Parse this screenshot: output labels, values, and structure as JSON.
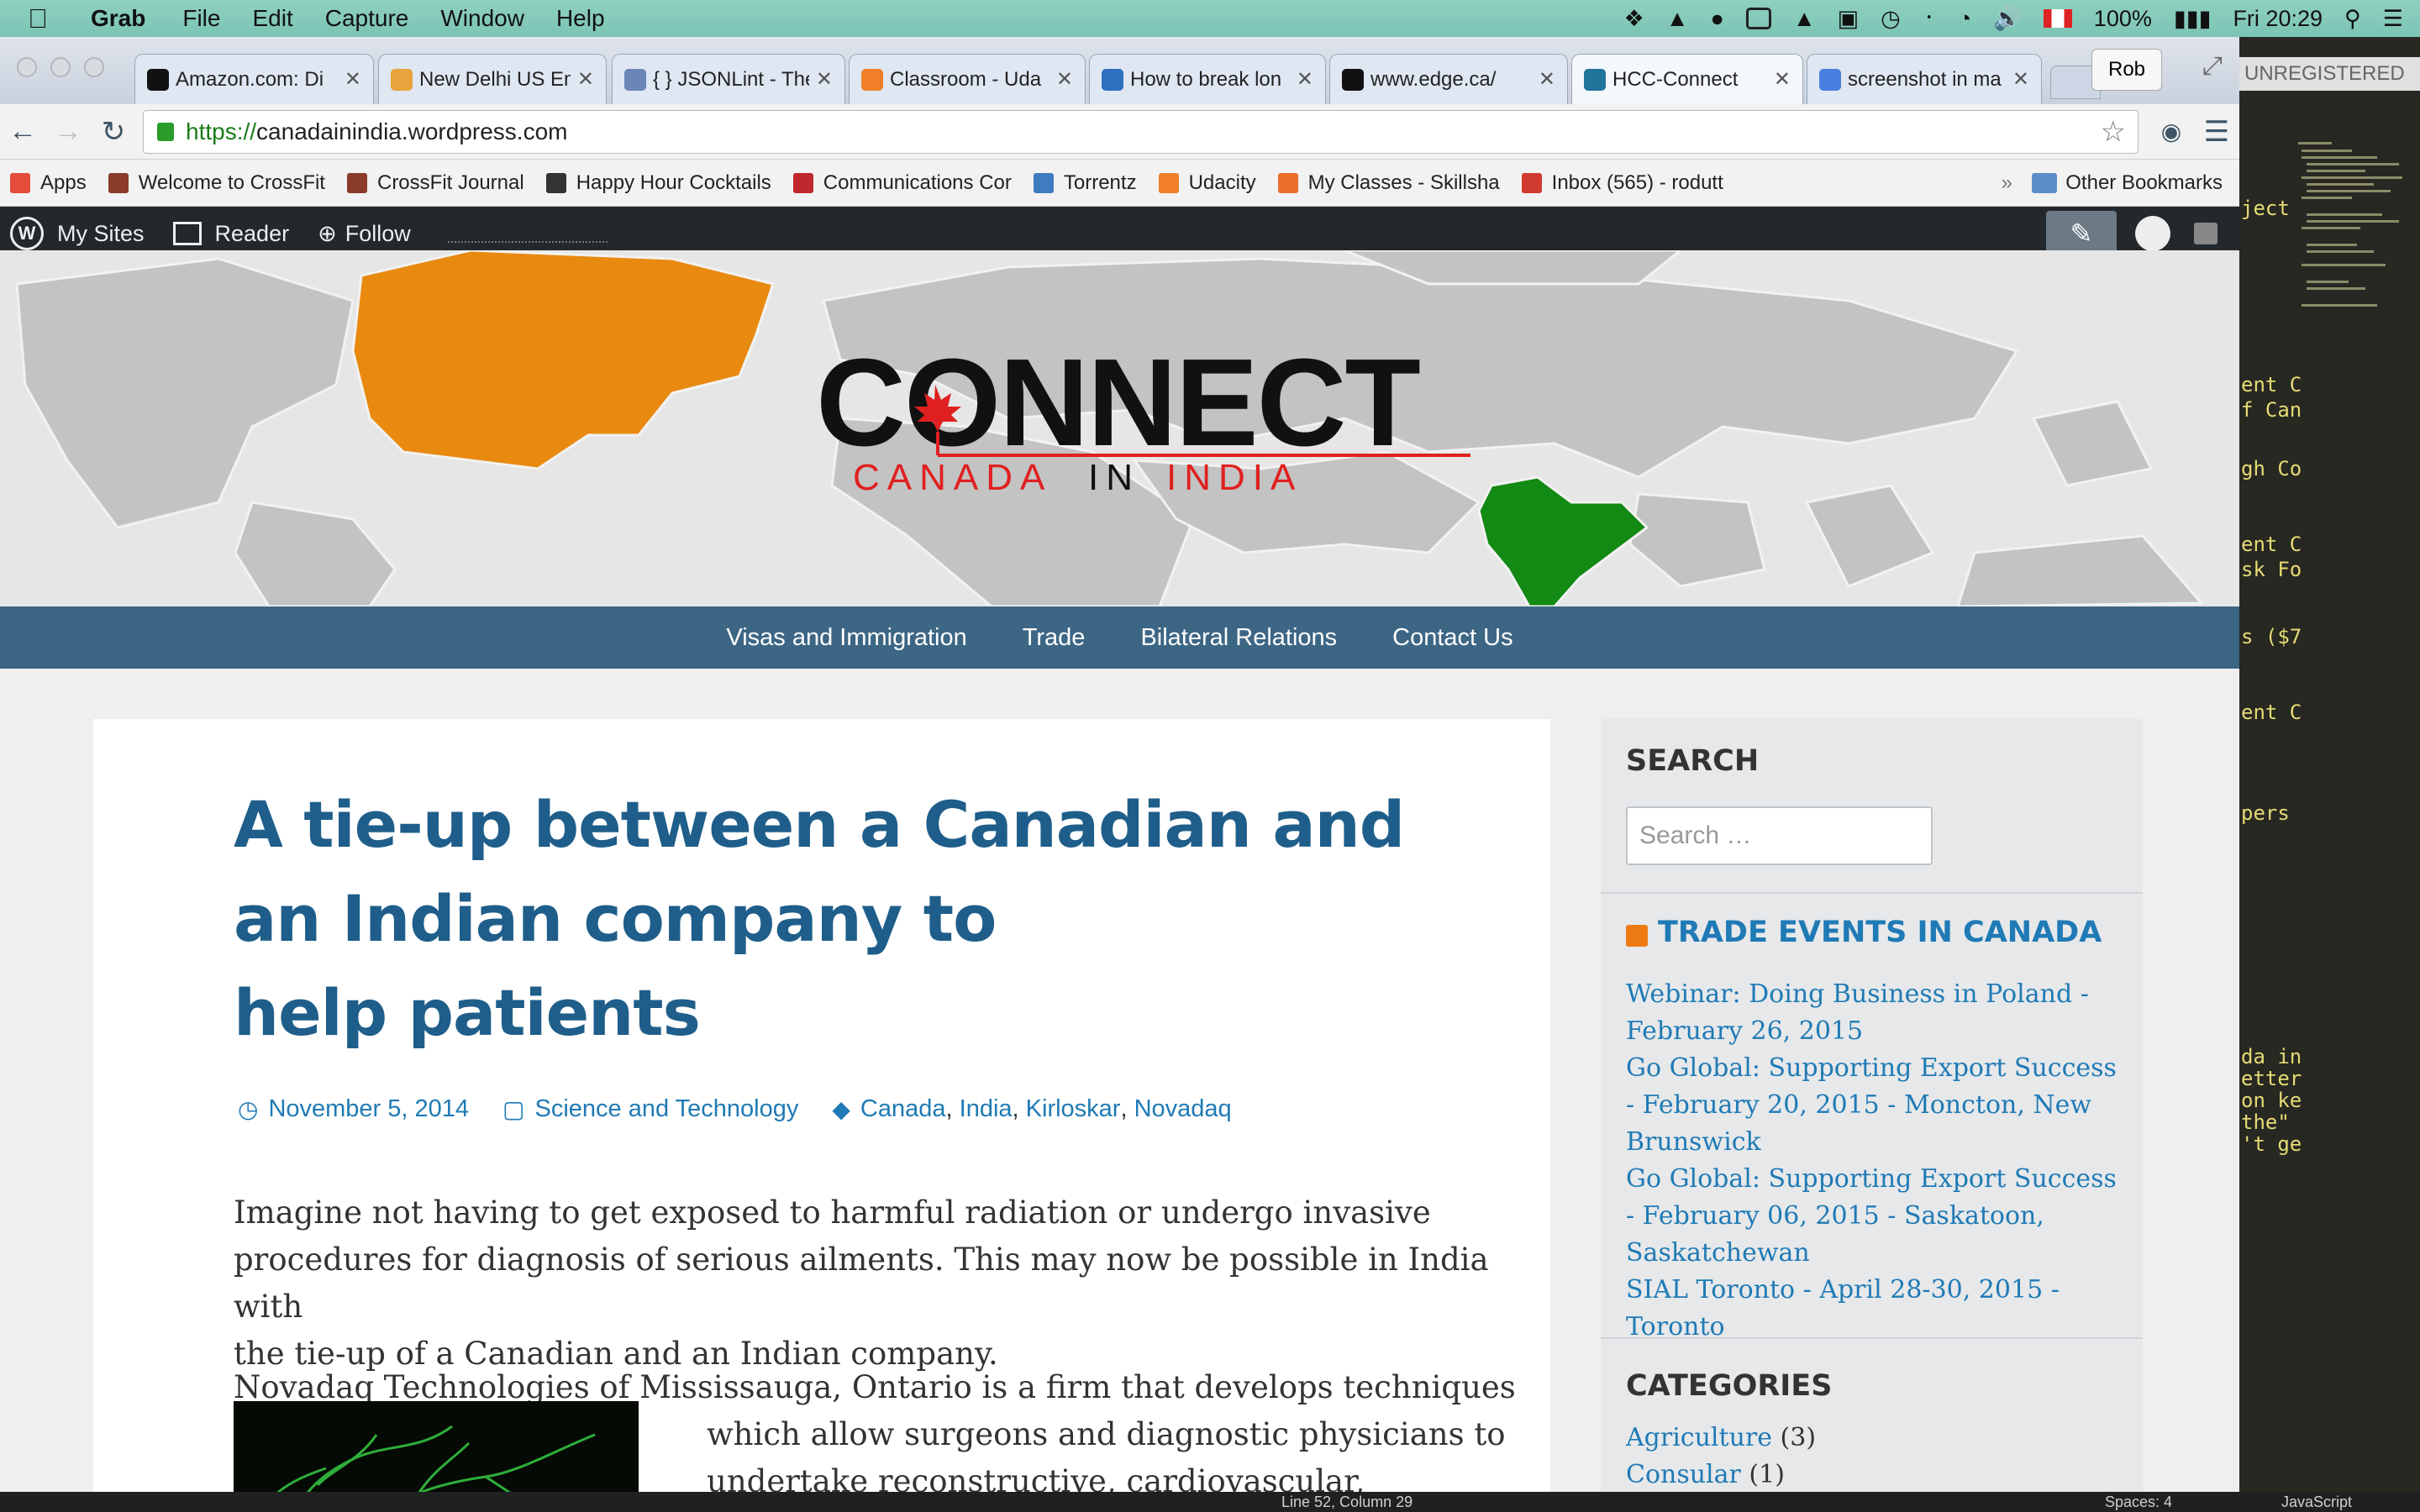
{
  "menubar": {
    "app": "Grab",
    "items": [
      "File",
      "Edit",
      "Capture",
      "Window",
      "Help"
    ],
    "battery": "100%",
    "clock": "Fri 20:29"
  },
  "tabs": [
    {
      "title": "Amazon.com: Di",
      "color": "#111111"
    },
    {
      "title": "New Delhi US Em",
      "color": "#e8a33c"
    },
    {
      "title": "{ } JSONLint - The JS",
      "color": "#6b86b6"
    },
    {
      "title": "Classroom - Uda",
      "color": "#f07f27"
    },
    {
      "title": "How to break lon",
      "color": "#2e6fbf"
    },
    {
      "title": "www.edge.ca/",
      "color": "#111111"
    },
    {
      "title": "HCC-Connect",
      "color": "#21759b"
    },
    {
      "title": "screenshot in ma",
      "color": "#4a7fe0"
    }
  ],
  "profile": "Rob",
  "address": {
    "scheme": "https://",
    "host": "canadainindia.wordpress.com"
  },
  "bookmarks": [
    {
      "label": "Apps",
      "color": "#e44c3c"
    },
    {
      "label": "Welcome to CrossFit",
      "color": "#8a3b2a"
    },
    {
      "label": "CrossFit Journal",
      "color": "#8a3b2a"
    },
    {
      "label": "Happy Hour Cocktails",
      "color": "#333333"
    },
    {
      "label": "Communications Cor",
      "color": "#c0282d"
    },
    {
      "label": "Torrentz",
      "color": "#3f7bbf"
    },
    {
      "label": "Udacity",
      "color": "#f07f27"
    },
    {
      "label": "My Classes - Skillsha",
      "color": "#e96f2a"
    },
    {
      "label": "Inbox (565) - rodutt",
      "color": "#d13b2f"
    }
  ],
  "bookmarks_other": "Other Bookmarks",
  "wpbar": {
    "my_sites": "My Sites",
    "reader": "Reader",
    "follow": "Follow"
  },
  "banner": {
    "logo_word": "CONNECT",
    "logo_sub_left": "CANADA",
    "logo_sub_mid": "IN",
    "logo_sub_right": "INDIA"
  },
  "nav": [
    "Visas and Immigration",
    "Trade",
    "Bilateral Relations",
    "Contact Us"
  ],
  "post": {
    "title_lines": [
      "A tie-up between a Canadian and",
      "an Indian company to",
      "help patients"
    ],
    "date": "November 5, 2014",
    "category": "Science and Technology",
    "tags": [
      "Canada",
      "India",
      "Kirloskar",
      "Novadaq"
    ],
    "para1_lines": [
      "Imagine not having to get exposed to harmful radiation or undergo invasive",
      "procedures for diagnosis of serious ailments. This may now be possible in India with",
      "the tie-up of a Canadian and an Indian company."
    ],
    "para2_first": "Novadaq Technologies of Mississauga, Ontario is a firm that develops  techniques",
    "para2_rest": [
      "which allow surgeons and diagnostic physicians to",
      "undertake reconstructive, cardiovascular,"
    ]
  },
  "sidebar": {
    "search_title": "SEARCH",
    "search_placeholder": "Search …",
    "rss_title": "TRADE EVENTS IN CANADA",
    "events": [
      "Webinar: Doing Business in Poland - February 26, 2015",
      "Go Global: Supporting Export Success - February 20, 2015 - Moncton, New Brunswick",
      "Go Global: Supporting Export Success - February 06, 2015 - Saskatoon, Saskatchewan",
      "SIAL Toronto - April 28-30, 2015 - Toronto"
    ],
    "categories_title": "CATEGORIES",
    "categories": [
      {
        "name": "Agriculture",
        "count": "(3)"
      },
      {
        "name": "Consular",
        "count": "(1)"
      }
    ]
  },
  "editor": {
    "unregistered": "UNREGISTERED",
    "snippets": [
      "ject",
      "ent C",
      "f Can",
      "gh Co",
      "ent C",
      "sk Fo",
      "s ($7",
      "ent C",
      "pers",
      "da in",
      "etter",
      "on ke",
      "the\"",
      "'t ge"
    ]
  },
  "statusbar": {
    "left": "Line 52, Column 29",
    "spaces": "Spaces: 4",
    "syntax": "JavaScript"
  },
  "colors": {
    "nav_band": "#3d6685",
    "title": "#1f5e8a",
    "link": "#1f7ab5",
    "canada": "#e88a10",
    "india": "#138a13",
    "logo_red": "#e02020"
  }
}
